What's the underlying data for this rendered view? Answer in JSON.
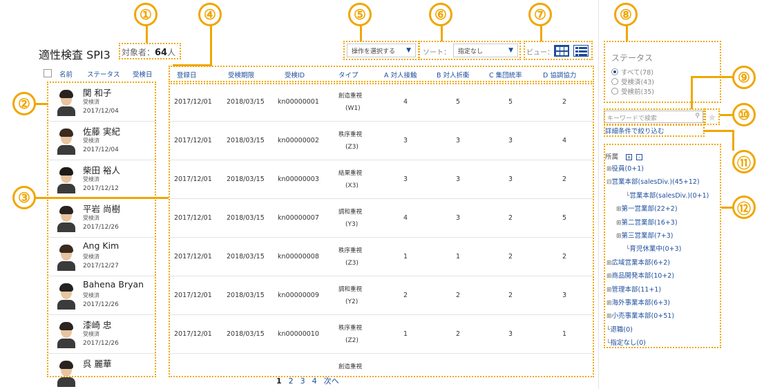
{
  "header": {
    "title": "適性検査 SPI3",
    "count_label": "対象者：",
    "count_value": "64",
    "count_unit": "人"
  },
  "toolbar": {
    "action_select": "操作を選択する",
    "sort_label": "ソート：",
    "sort_select": "指定なし",
    "view_label": "ビュー："
  },
  "list_headers": {
    "name": "名前",
    "status": "ステータス",
    "date": "受検日"
  },
  "people": [
    {
      "name": "関 和子",
      "status": "受検済",
      "date": "2017/12/04"
    },
    {
      "name": "佐藤 実紀",
      "status": "受検済",
      "date": "2017/12/04"
    },
    {
      "name": "柴田 裕人",
      "status": "受検済",
      "date": "2017/12/12"
    },
    {
      "name": "平岩 尚樹",
      "status": "受検済",
      "date": "2017/12/26"
    },
    {
      "name": "Ang Kim",
      "status": "受検済",
      "date": "2017/12/27"
    },
    {
      "name": "Bahena Bryan",
      "status": "受検済",
      "date": "2017/12/26"
    },
    {
      "name": "漆崎 忠",
      "status": "受検済",
      "date": "2017/12/26"
    },
    {
      "name": "呉 麗華",
      "status": "",
      "date": ""
    }
  ],
  "table_headers": [
    "登録日",
    "受検期限",
    "受検ID",
    "タイプ",
    "A 対人接触",
    "B 対人折衝",
    "C 集団統率",
    "D 協調協力"
  ],
  "rows": [
    {
      "reg": "2017/12/01",
      "limit": "2018/03/15",
      "id": "kn00000001",
      "type1": "創造重視",
      "type2": "(W1)",
      "a": "4",
      "b": "5",
      "c": "5",
      "d": "2"
    },
    {
      "reg": "2017/12/01",
      "limit": "2018/03/15",
      "id": "kn00000002",
      "type1": "秩序重視",
      "type2": "(Z3)",
      "a": "3",
      "b": "3",
      "c": "3",
      "d": "4"
    },
    {
      "reg": "2017/12/01",
      "limit": "2018/03/15",
      "id": "kn00000003",
      "type1": "結果重視",
      "type2": "(X3)",
      "a": "3",
      "b": "3",
      "c": "3",
      "d": "2"
    },
    {
      "reg": "2017/12/01",
      "limit": "2018/03/15",
      "id": "kn00000007",
      "type1": "調和重視",
      "type2": "(Y3)",
      "a": "4",
      "b": "3",
      "c": "2",
      "d": "5"
    },
    {
      "reg": "2017/12/01",
      "limit": "2018/03/15",
      "id": "kn00000008",
      "type1": "秩序重視",
      "type2": "(Z3)",
      "a": "1",
      "b": "1",
      "c": "2",
      "d": "2"
    },
    {
      "reg": "2017/12/01",
      "limit": "2018/03/15",
      "id": "kn00000009",
      "type1": "調和重視",
      "type2": "(Y2)",
      "a": "2",
      "b": "2",
      "c": "2",
      "d": "3"
    },
    {
      "reg": "2017/12/01",
      "limit": "2018/03/15",
      "id": "kn00000010",
      "type1": "秩序重視",
      "type2": "(Z2)",
      "a": "1",
      "b": "2",
      "c": "3",
      "d": "1"
    },
    {
      "reg": "",
      "limit": "",
      "id": "",
      "type1": "創造重視",
      "type2": "",
      "a": "",
      "b": "",
      "c": "",
      "d": ""
    }
  ],
  "pager": [
    "1",
    "2",
    "3",
    "4",
    "次へ"
  ],
  "status_panel": {
    "title": "ステータス",
    "options": [
      "すべて(78)",
      "受検済(43)",
      "受検前(35)"
    ]
  },
  "search": {
    "placeholder": "キーワードで検索"
  },
  "advanced_link": "詳細条件で絞り込む",
  "tree": {
    "label": "所属",
    "items": [
      "役員(0+1)",
      "営業本部(salesDiv.)(45+12)",
      "営業本部(salesDiv.)(0+1)",
      "第一営業部(22+2)",
      "第二営業部(16+3)",
      "第三営業部(7+3)",
      "育児休業中(0+3)",
      "広域営業本部(6+2)",
      "商品開発本部(10+2)",
      "管理本部(11+1)",
      "海外事業本部(6+3)",
      "小売事業本部(0+51)",
      "退職(0)",
      "指定なし(0)"
    ]
  },
  "callouts": [
    "①",
    "②",
    "③",
    "④",
    "⑤",
    "⑥",
    "⑦",
    "⑧",
    "⑨",
    "⑩",
    "⑪",
    "⑫"
  ],
  "colors": {
    "accent": "#f0a600",
    "link": "#1d4e9c"
  }
}
